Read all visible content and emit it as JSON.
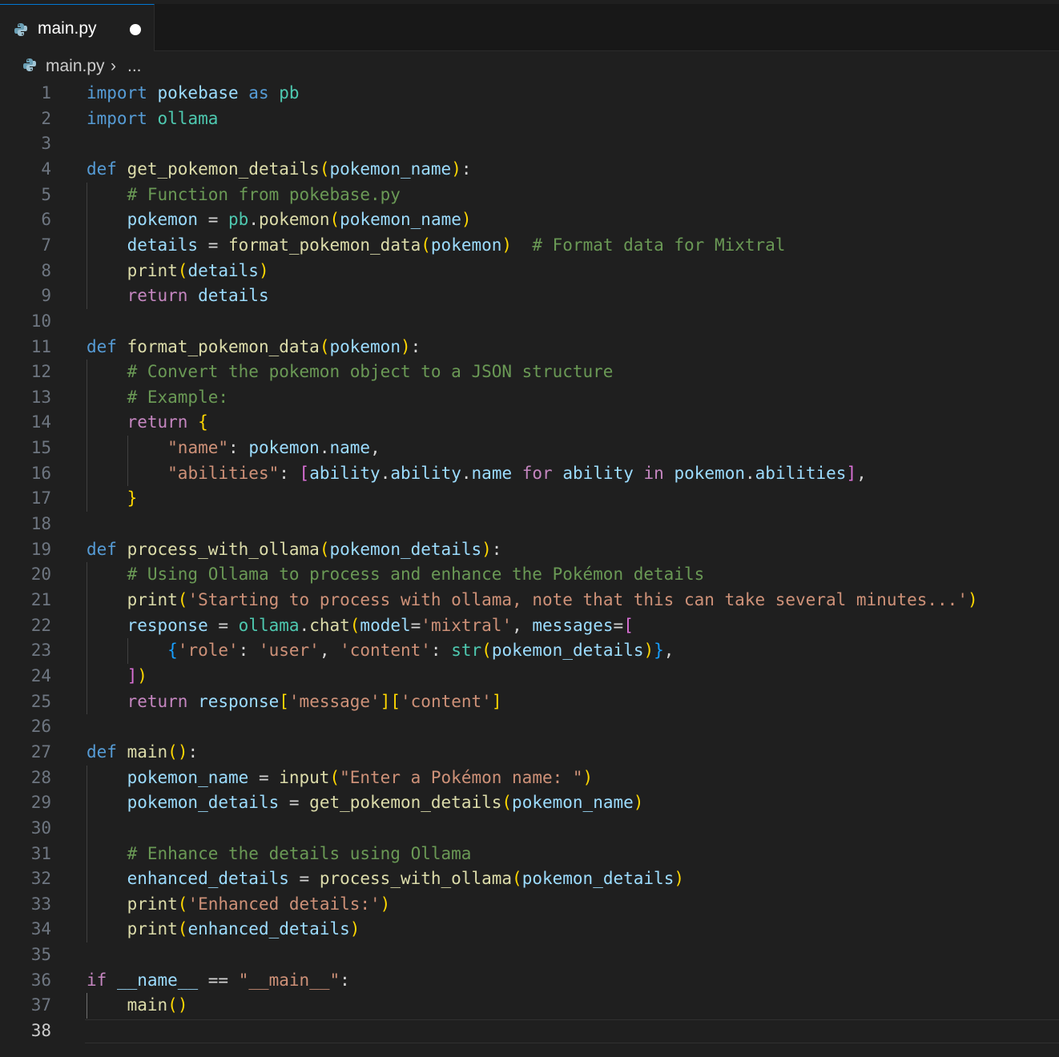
{
  "tab": {
    "label": "main.py",
    "file_icon": "python-icon",
    "state": "unsaved"
  },
  "breadcrumb": {
    "file": "main.py",
    "separator": "›",
    "more": "..."
  },
  "editor": {
    "active_line": 38,
    "lines": [
      [
        [
          "import",
          "kw"
        ],
        [
          " pokebase ",
          "var"
        ],
        [
          "as",
          "kw"
        ],
        [
          " ",
          ""
        ],
        [
          "pb",
          "cls"
        ]
      ],
      [
        [
          "import",
          "kw"
        ],
        [
          " ",
          ""
        ],
        [
          "ollama",
          "cls"
        ]
      ],
      [],
      [
        [
          "def",
          "kw"
        ],
        [
          " ",
          ""
        ],
        [
          "get_pokemon_details",
          "fn"
        ],
        [
          "(",
          "b1"
        ],
        [
          "pokemon_name",
          "var"
        ],
        [
          ")",
          "b1"
        ],
        [
          ":",
          "op"
        ]
      ],
      [
        [
          "    ",
          ""
        ],
        [
          "# Function from pokebase.py",
          "cmt"
        ]
      ],
      [
        [
          "    ",
          ""
        ],
        [
          "pokemon",
          "var"
        ],
        [
          " = ",
          "op"
        ],
        [
          "pb",
          "cls"
        ],
        [
          ".",
          "op"
        ],
        [
          "pokemon",
          "fn"
        ],
        [
          "(",
          "b1"
        ],
        [
          "pokemon_name",
          "var"
        ],
        [
          ")",
          "b1"
        ]
      ],
      [
        [
          "    ",
          ""
        ],
        [
          "details",
          "var"
        ],
        [
          " = ",
          "op"
        ],
        [
          "format_pokemon_data",
          "fn"
        ],
        [
          "(",
          "b1"
        ],
        [
          "pokemon",
          "var"
        ],
        [
          ")",
          "b1"
        ],
        [
          "  ",
          ""
        ],
        [
          "# Format data for Mixtral",
          "cmt"
        ]
      ],
      [
        [
          "    ",
          ""
        ],
        [
          "print",
          "fn"
        ],
        [
          "(",
          "b1"
        ],
        [
          "details",
          "var"
        ],
        [
          ")",
          "b1"
        ]
      ],
      [
        [
          "    ",
          ""
        ],
        [
          "return",
          "ctl"
        ],
        [
          " ",
          ""
        ],
        [
          "details",
          "var"
        ]
      ],
      [],
      [
        [
          "def",
          "kw"
        ],
        [
          " ",
          ""
        ],
        [
          "format_pokemon_data",
          "fn"
        ],
        [
          "(",
          "b1"
        ],
        [
          "pokemon",
          "var"
        ],
        [
          ")",
          "b1"
        ],
        [
          ":",
          "op"
        ]
      ],
      [
        [
          "    ",
          ""
        ],
        [
          "# Convert the pokemon object to a JSON structure",
          "cmt"
        ]
      ],
      [
        [
          "    ",
          ""
        ],
        [
          "# Example:",
          "cmt"
        ]
      ],
      [
        [
          "    ",
          ""
        ],
        [
          "return",
          "ctl"
        ],
        [
          " ",
          ""
        ],
        [
          "{",
          "b1"
        ]
      ],
      [
        [
          "        ",
          ""
        ],
        [
          "\"name\"",
          "str"
        ],
        [
          ": ",
          "op"
        ],
        [
          "pokemon",
          "var"
        ],
        [
          ".",
          "op"
        ],
        [
          "name",
          "var"
        ],
        [
          ",",
          "op"
        ]
      ],
      [
        [
          "        ",
          ""
        ],
        [
          "\"abilities\"",
          "str"
        ],
        [
          ": ",
          "op"
        ],
        [
          "[",
          "b2"
        ],
        [
          "ability",
          "var"
        ],
        [
          ".",
          "op"
        ],
        [
          "ability",
          "var"
        ],
        [
          ".",
          "op"
        ],
        [
          "name",
          "var"
        ],
        [
          " ",
          ""
        ],
        [
          "for",
          "ctl"
        ],
        [
          " ",
          ""
        ],
        [
          "ability",
          "var"
        ],
        [
          " ",
          ""
        ],
        [
          "in",
          "ctl"
        ],
        [
          " ",
          ""
        ],
        [
          "pokemon",
          "var"
        ],
        [
          ".",
          "op"
        ],
        [
          "abilities",
          "var"
        ],
        [
          "]",
          "b2"
        ],
        [
          ",",
          "op"
        ]
      ],
      [
        [
          "    ",
          ""
        ],
        [
          "}",
          "b1"
        ]
      ],
      [],
      [
        [
          "def",
          "kw"
        ],
        [
          " ",
          ""
        ],
        [
          "process_with_ollama",
          "fn"
        ],
        [
          "(",
          "b1"
        ],
        [
          "pokemon_details",
          "var"
        ],
        [
          ")",
          "b1"
        ],
        [
          ":",
          "op"
        ]
      ],
      [
        [
          "    ",
          ""
        ],
        [
          "# Using Ollama to process and enhance the Pokémon details",
          "cmt"
        ]
      ],
      [
        [
          "    ",
          ""
        ],
        [
          "print",
          "fn"
        ],
        [
          "(",
          "b1"
        ],
        [
          "'Starting to process with ollama, note that this can take several minutes...'",
          "str"
        ],
        [
          ")",
          "b1"
        ]
      ],
      [
        [
          "    ",
          ""
        ],
        [
          "response",
          "var"
        ],
        [
          " = ",
          "op"
        ],
        [
          "ollama",
          "cls"
        ],
        [
          ".",
          "op"
        ],
        [
          "chat",
          "fn"
        ],
        [
          "(",
          "b1"
        ],
        [
          "model",
          "var"
        ],
        [
          "=",
          "op"
        ],
        [
          "'mixtral'",
          "str"
        ],
        [
          ", ",
          "op"
        ],
        [
          "messages",
          "var"
        ],
        [
          "=",
          "op"
        ],
        [
          "[",
          "b2"
        ]
      ],
      [
        [
          "        ",
          ""
        ],
        [
          "{",
          "b3"
        ],
        [
          "'role'",
          "str"
        ],
        [
          ": ",
          "op"
        ],
        [
          "'user'",
          "str"
        ],
        [
          ", ",
          "op"
        ],
        [
          "'content'",
          "str"
        ],
        [
          ": ",
          "op"
        ],
        [
          "str",
          "cls"
        ],
        [
          "(",
          "b1"
        ],
        [
          "pokemon_details",
          "var"
        ],
        [
          ")",
          "b1"
        ],
        [
          "}",
          "b3"
        ],
        [
          ",",
          "op"
        ]
      ],
      [
        [
          "    ",
          ""
        ],
        [
          "]",
          "b2"
        ],
        [
          ")",
          "b1"
        ]
      ],
      [
        [
          "    ",
          ""
        ],
        [
          "return",
          "ctl"
        ],
        [
          " ",
          ""
        ],
        [
          "response",
          "var"
        ],
        [
          "[",
          "b1"
        ],
        [
          "'message'",
          "str"
        ],
        [
          "]",
          "b1"
        ],
        [
          "[",
          "b1"
        ],
        [
          "'content'",
          "str"
        ],
        [
          "]",
          "b1"
        ]
      ],
      [],
      [
        [
          "def",
          "kw"
        ],
        [
          " ",
          ""
        ],
        [
          "main",
          "fn"
        ],
        [
          "(",
          "b1"
        ],
        [
          ")",
          "b1"
        ],
        [
          ":",
          "op"
        ]
      ],
      [
        [
          "    ",
          ""
        ],
        [
          "pokemon_name",
          "var"
        ],
        [
          " = ",
          "op"
        ],
        [
          "input",
          "fn"
        ],
        [
          "(",
          "b1"
        ],
        [
          "\"Enter a Pokémon name: \"",
          "str"
        ],
        [
          ")",
          "b1"
        ]
      ],
      [
        [
          "    ",
          ""
        ],
        [
          "pokemon_details",
          "var"
        ],
        [
          " = ",
          "op"
        ],
        [
          "get_pokemon_details",
          "fn"
        ],
        [
          "(",
          "b1"
        ],
        [
          "pokemon_name",
          "var"
        ],
        [
          ")",
          "b1"
        ]
      ],
      [],
      [
        [
          "    ",
          ""
        ],
        [
          "# Enhance the details using Ollama",
          "cmt"
        ]
      ],
      [
        [
          "    ",
          ""
        ],
        [
          "enhanced_details",
          "var"
        ],
        [
          " = ",
          "op"
        ],
        [
          "process_with_ollama",
          "fn"
        ],
        [
          "(",
          "b1"
        ],
        [
          "pokemon_details",
          "var"
        ],
        [
          ")",
          "b1"
        ]
      ],
      [
        [
          "    ",
          ""
        ],
        [
          "print",
          "fn"
        ],
        [
          "(",
          "b1"
        ],
        [
          "'Enhanced details:'",
          "str"
        ],
        [
          ")",
          "b1"
        ]
      ],
      [
        [
          "    ",
          ""
        ],
        [
          "print",
          "fn"
        ],
        [
          "(",
          "b1"
        ],
        [
          "enhanced_details",
          "var"
        ],
        [
          ")",
          "b1"
        ]
      ],
      [],
      [
        [
          "if",
          "ctl"
        ],
        [
          " ",
          ""
        ],
        [
          "__name__",
          "var"
        ],
        [
          " == ",
          "op"
        ],
        [
          "\"__main__\"",
          "str"
        ],
        [
          ":",
          "op"
        ]
      ],
      [
        [
          "    ",
          ""
        ],
        [
          "main",
          "fn"
        ],
        [
          "(",
          "b1"
        ],
        [
          ")",
          "b1"
        ]
      ],
      []
    ]
  },
  "colors": {
    "background": "#1f1f1f",
    "keyword": "#569cd6",
    "control": "#c586c0",
    "function": "#dcdcaa",
    "variable": "#9cdcfe",
    "string": "#ce9178",
    "comment": "#6a9955",
    "module": "#4ec9b0",
    "bracket_1": "#ffd700",
    "bracket_2": "#da70d6",
    "bracket_3": "#179fff"
  }
}
